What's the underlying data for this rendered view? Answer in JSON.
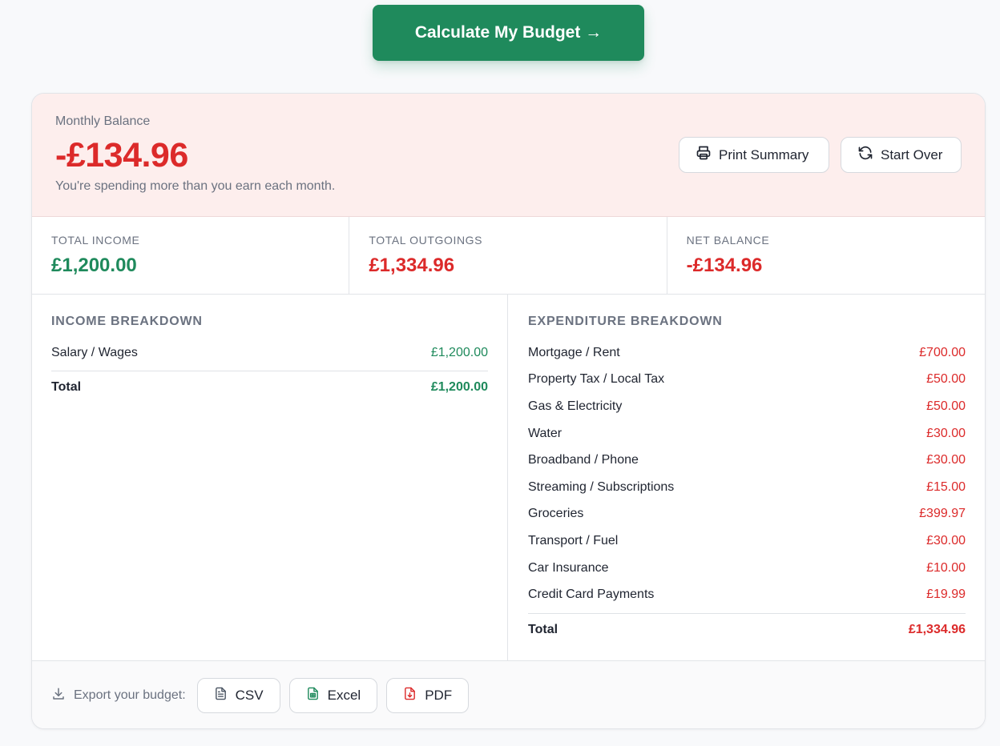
{
  "calculate_button": {
    "label": "Calculate My Budget →"
  },
  "balance": {
    "label": "Monthly Balance",
    "value": "-£134.96",
    "note": "You're spending more than you earn each month.",
    "print_label": "Print Summary",
    "start_over_label": "Start Over"
  },
  "stats": [
    {
      "label": "TOTAL INCOME",
      "value": "£1,200.00",
      "tone": "positive"
    },
    {
      "label": "TOTAL OUTGOINGS",
      "value": "£1,334.96",
      "tone": "negative"
    },
    {
      "label": "NET BALANCE",
      "value": "-£134.96",
      "tone": "negative"
    }
  ],
  "income": {
    "title": "INCOME BREAKDOWN",
    "items": [
      {
        "label": "Salary / Wages",
        "amount": "£1,200.00"
      }
    ],
    "total_label": "Total",
    "total_amount": "£1,200.00"
  },
  "expenditure": {
    "title": "EXPENDITURE BREAKDOWN",
    "items": [
      {
        "label": "Mortgage / Rent",
        "amount": "£700.00"
      },
      {
        "label": "Property Tax / Local Tax",
        "amount": "£50.00"
      },
      {
        "label": "Gas & Electricity",
        "amount": "£50.00"
      },
      {
        "label": "Water",
        "amount": "£30.00"
      },
      {
        "label": "Broadband / Phone",
        "amount": "£30.00"
      },
      {
        "label": "Streaming / Subscriptions",
        "amount": "£15.00"
      },
      {
        "label": "Groceries",
        "amount": "£399.97"
      },
      {
        "label": "Transport / Fuel",
        "amount": "£30.00"
      },
      {
        "label": "Car Insurance",
        "amount": "£10.00"
      },
      {
        "label": "Credit Card Payments",
        "amount": "£19.99"
      }
    ],
    "total_label": "Total",
    "total_amount": "£1,334.96"
  },
  "export": {
    "label": "Export your budget:",
    "csv_label": "CSV",
    "excel_label": "Excel",
    "pdf_label": "PDF"
  },
  "colors": {
    "brand_green": "#1f8a5c",
    "negative_red": "#dc2a2a",
    "alert_bg": "#fdeeed"
  }
}
